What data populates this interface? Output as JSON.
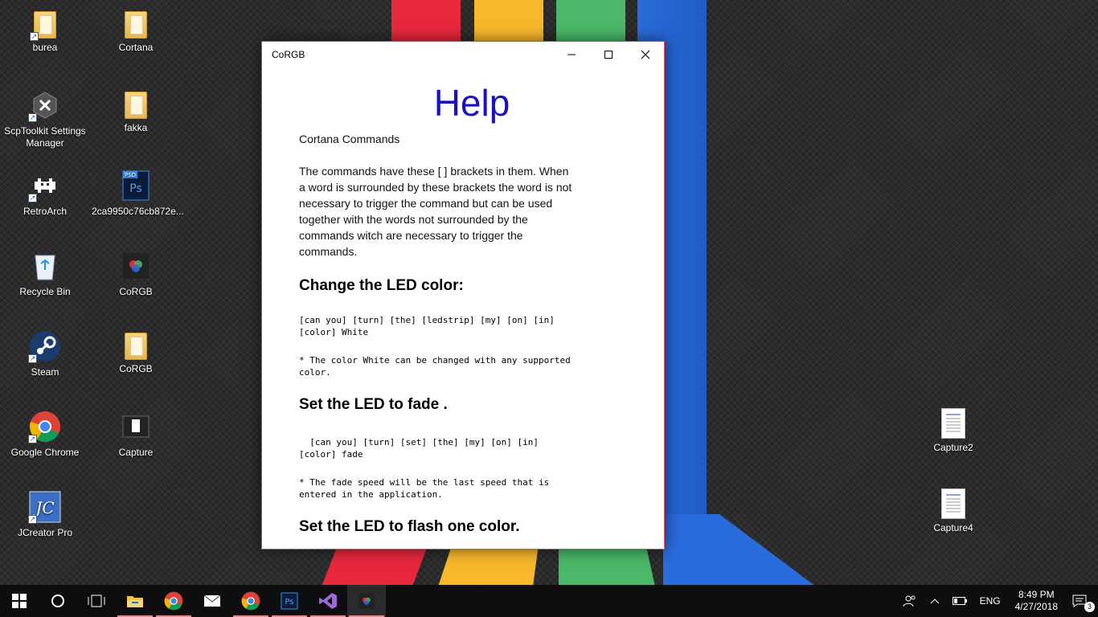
{
  "desktop": {
    "icons": [
      {
        "label": "burea"
      },
      {
        "label": "Cortana"
      },
      {
        "label": "ScpToolkit Settings Manager"
      },
      {
        "label": "fakka"
      },
      {
        "label": "RetroArch"
      },
      {
        "label": "2ca9950c76cb872e..."
      },
      {
        "label": "Recycle Bin"
      },
      {
        "label": "CoRGB"
      },
      {
        "label": "Steam"
      },
      {
        "label": "CoRGB"
      },
      {
        "label": "Google Chrome"
      },
      {
        "label": "Capture"
      },
      {
        "label": "JCreator Pro"
      },
      {
        "label": "Capture2"
      },
      {
        "label": "Capture4"
      }
    ]
  },
  "window": {
    "title": "CoRGB",
    "min_glyph": "—",
    "max_glyph": "☐",
    "close_glyph": "✕"
  },
  "help": {
    "heading": "Help",
    "subtitle": "Cortana Commands",
    "intro": "The commands have these [ ] brackets in them. When a word is surrounded by these brackets the word is not necessary to trigger the command but can be used together with the words not surrounded by the commands witch are necessary to trigger the commands.",
    "section1_title": "Change the LED color:",
    "section1_cmd": "[can you] [turn] [the] [ledstrip] [my] [on] [in] [color] White",
    "section1_note": "* The color White can be changed with any supported color.",
    "section2_title": "Set the LED to fade .",
    "section2_cmd": "  [can you] [turn] [set] [the] [my] [on] [in] [color] fade",
    "section2_note": "* The fade speed will be the last speed that is entered in the application.",
    "section3_title": "Set the LED to flash one color."
  },
  "taskbar": {
    "start_icon": "windows-logo",
    "lang": "ENG",
    "time": "8:49 PM",
    "date": "4/27/2018",
    "notif_count": "3"
  },
  "colors": {
    "accent": "#1a12c2",
    "window_border": "#e5484d"
  }
}
